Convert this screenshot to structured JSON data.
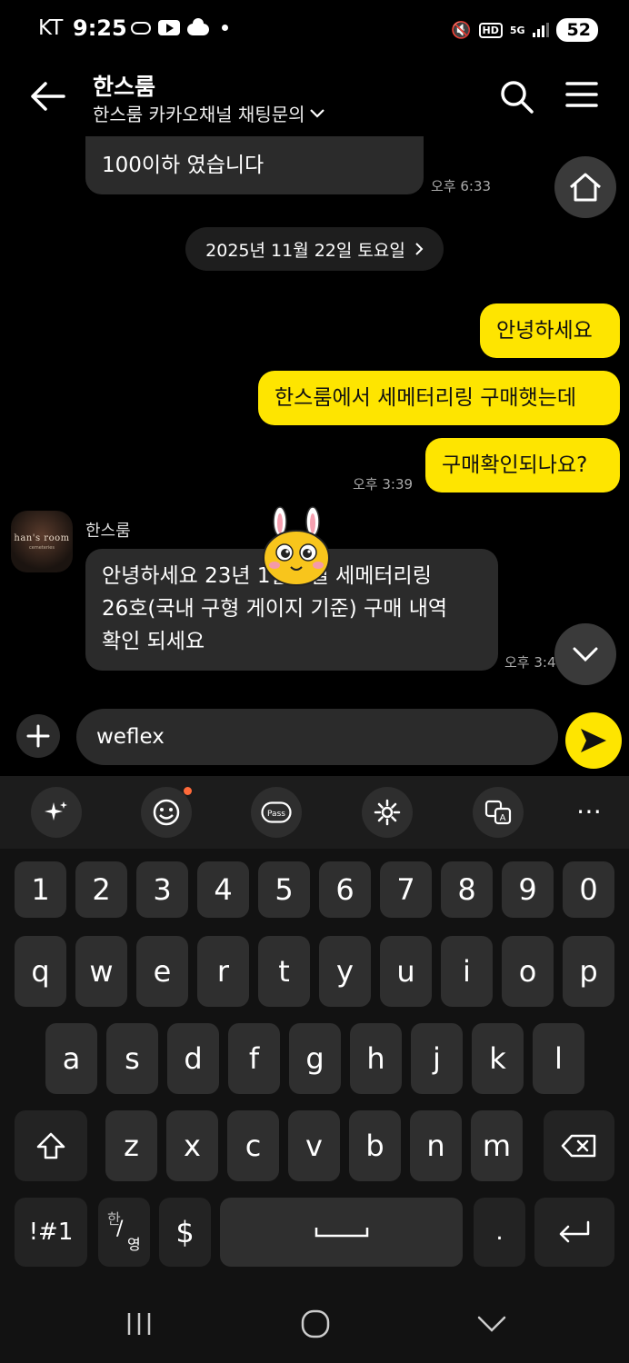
{
  "status_bar": {
    "carrier": "KT",
    "time": "9:25",
    "network": "5G",
    "hd_label": "HD",
    "battery": "52"
  },
  "header": {
    "title": "한스룸",
    "subtitle": "한스룸 카카오채널 채팅문의"
  },
  "messages": {
    "partial_text": "100이하 였습니다",
    "partial_time": "오후 6:33",
    "date_separator": "2025년 11월 22일 토요일",
    "sent": [
      "안녕하세요",
      "한스룸에서 세메터리링 구매햇는데",
      "구매확인되나요?"
    ],
    "sent_time": "오후 3:39",
    "sender_name": "한스룸",
    "received_lines": [
      "안녕하세요 23년 1월 9일 세메터리링",
      "26호(국내 구형 게이지 기준) 구매 내역",
      "확인 되세요"
    ],
    "received_time": "오후 3:44",
    "avatar_text": "han's room",
    "avatar_sub": "cemeteries"
  },
  "input": {
    "value": "weflex"
  },
  "keyboard": {
    "numbers": [
      "1",
      "2",
      "3",
      "4",
      "5",
      "6",
      "7",
      "8",
      "9",
      "0"
    ],
    "row1": [
      "q",
      "w",
      "e",
      "r",
      "t",
      "y",
      "u",
      "i",
      "o",
      "p"
    ],
    "row2": [
      "a",
      "s",
      "d",
      "f",
      "g",
      "h",
      "j",
      "k",
      "l"
    ],
    "row3": [
      "z",
      "x",
      "c",
      "v",
      "b",
      "n",
      "m"
    ],
    "symbols_key": "!#1",
    "lang_key_top": "한",
    "lang_key_bottom": "영",
    "currency_key": "$",
    "period_key": "."
  },
  "colors": {
    "accent": "#fee500",
    "bubble_dark": "#2b2b2b",
    "background": "#000000"
  }
}
